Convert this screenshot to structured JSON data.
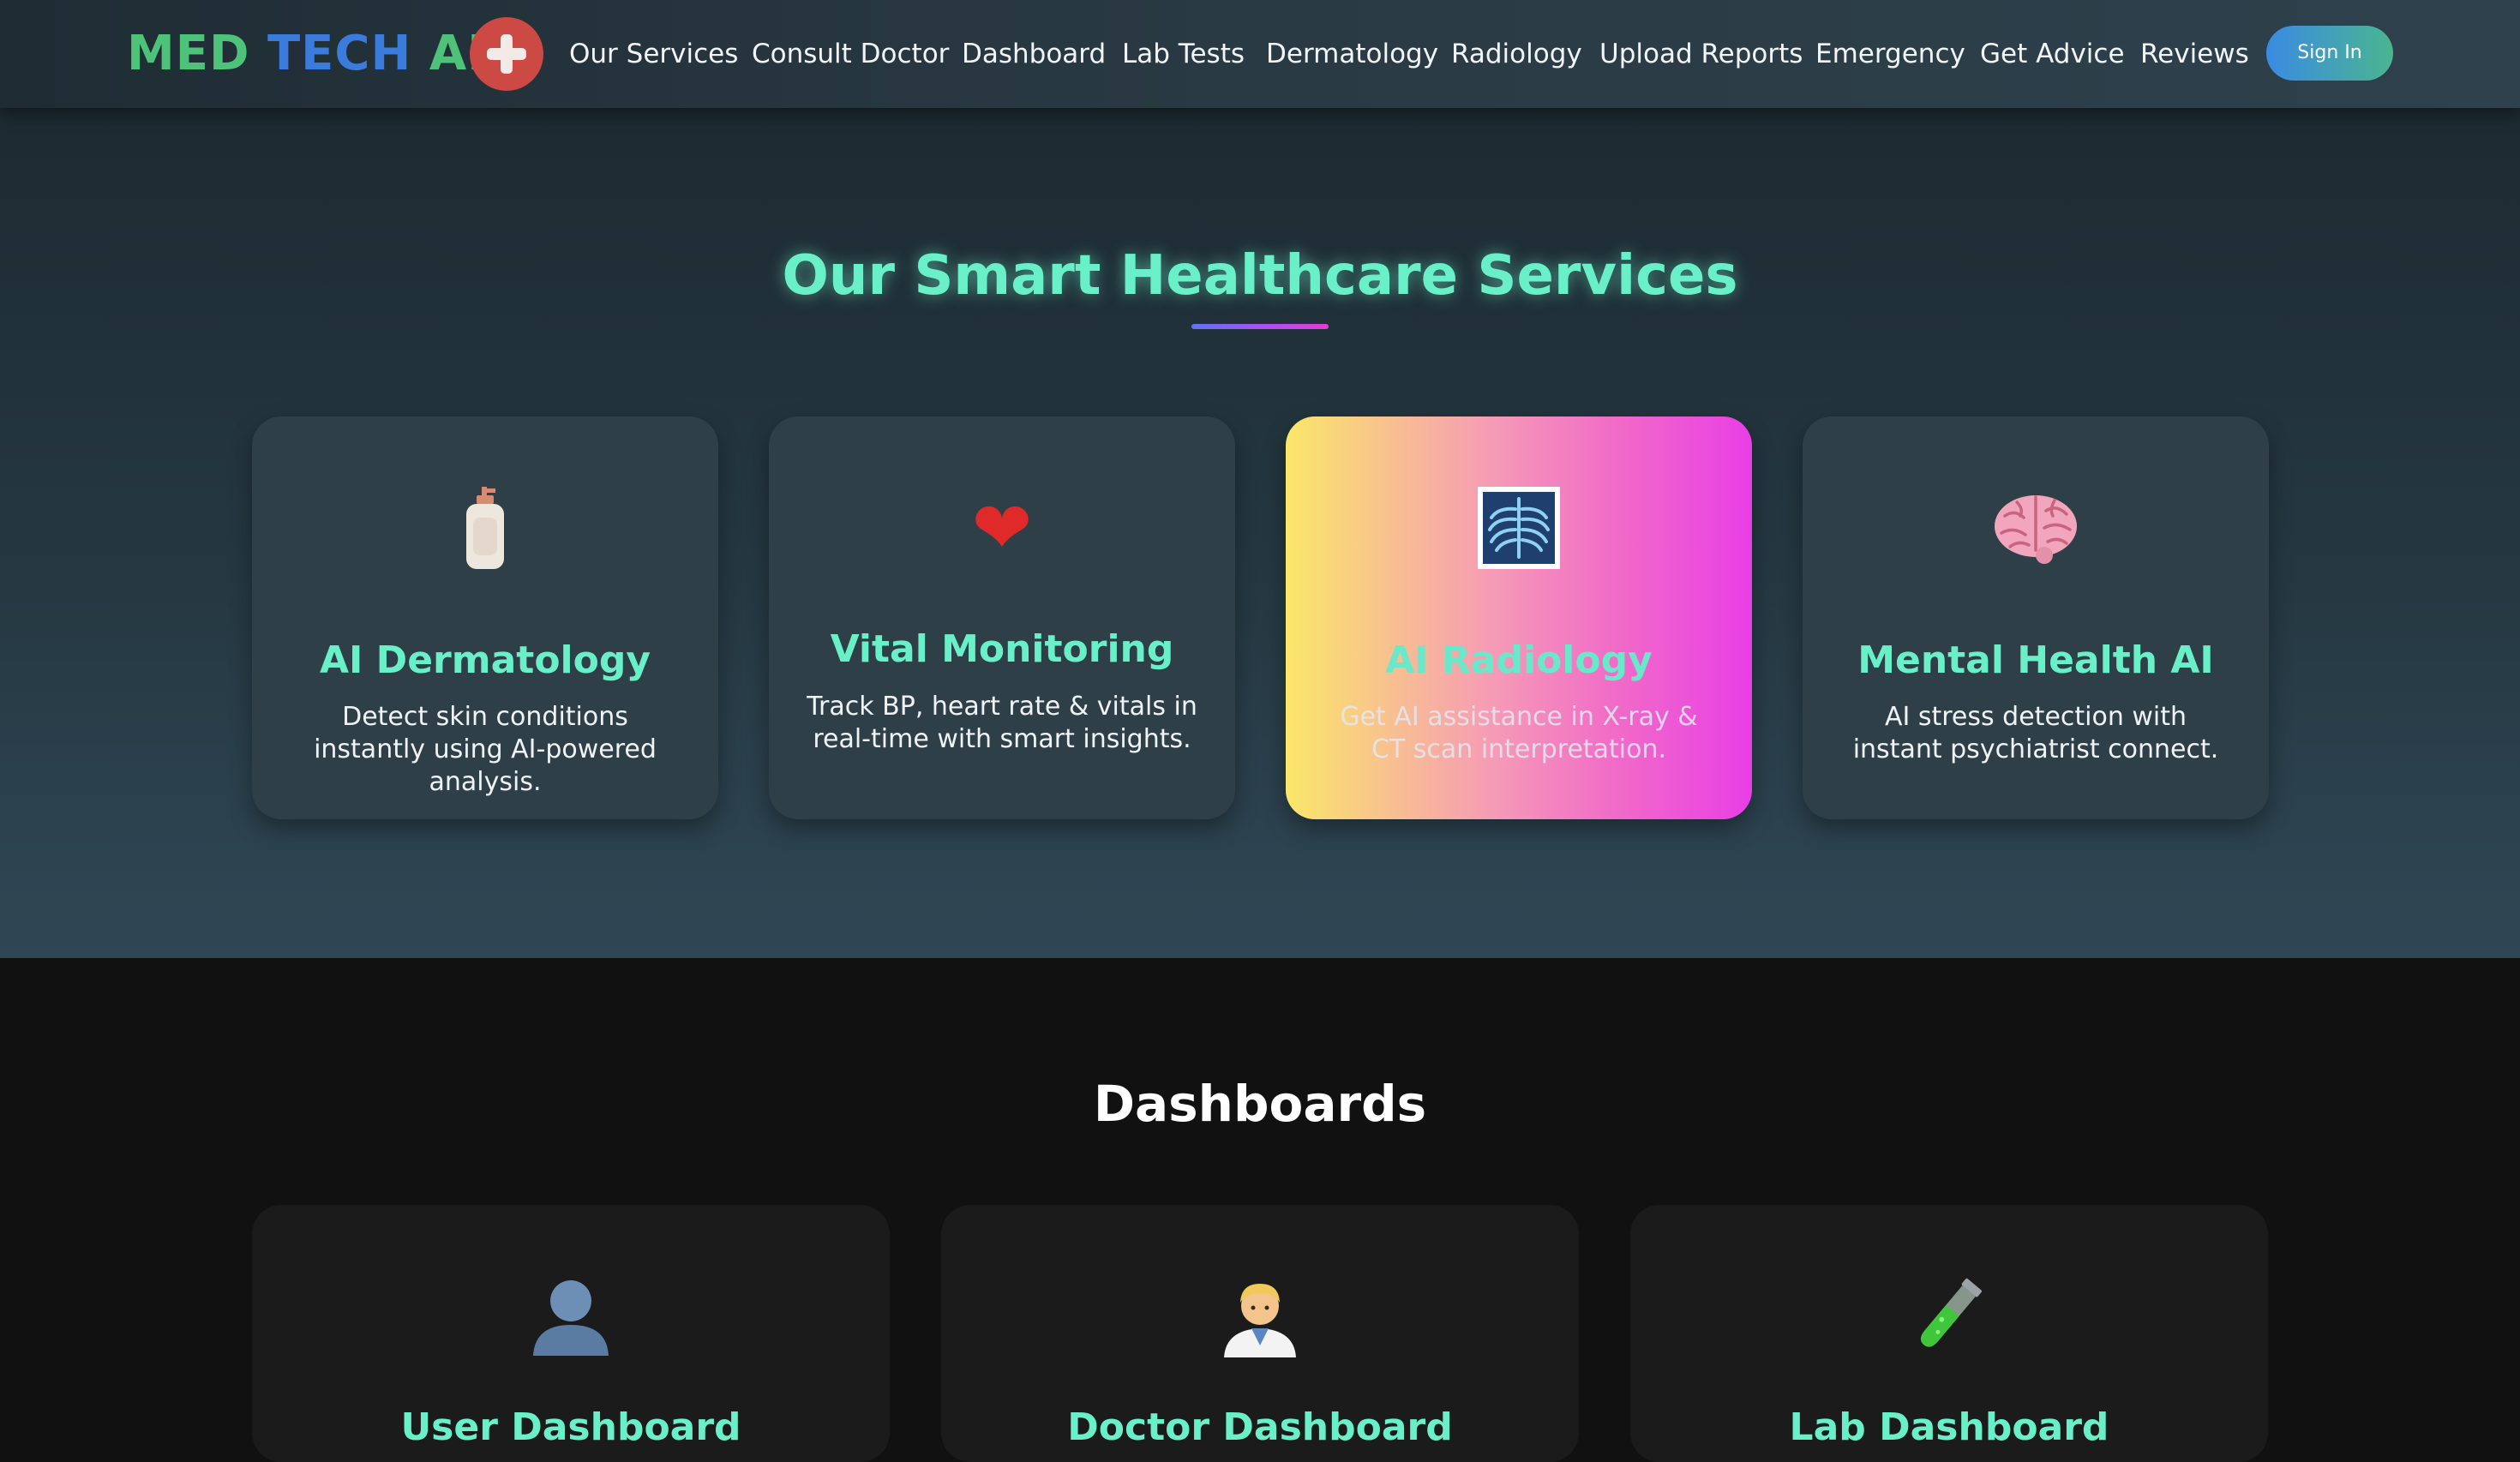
{
  "brand": {
    "part1": "MED",
    "part2": "TECH",
    "part3": "AI",
    "logo_icon": "red-cross-icon",
    "colors": {
      "green": "#4fc27a",
      "blue": "#3b7bdc",
      "cross_bg": "#cc4a43"
    }
  },
  "nav": {
    "items": [
      {
        "label": "Our Services"
      },
      {
        "label": "Consult Doctor"
      },
      {
        "label": "Dashboard"
      },
      {
        "label": "Lab Tests"
      },
      {
        "label": "Dermatology"
      },
      {
        "label": "Radiology"
      },
      {
        "label": "Upload Reports"
      },
      {
        "label": "Emergency"
      },
      {
        "label": "Get Advice"
      },
      {
        "label": "Reviews"
      }
    ],
    "sign_in": "Sign In"
  },
  "services": {
    "title": "Our Smart Healthcare Services",
    "cards": [
      {
        "icon": "lotion-bottle-icon",
        "title": "AI Dermatology",
        "desc": "Detect skin conditions instantly using AI-powered analysis.",
        "active": false
      },
      {
        "icon": "heart-icon",
        "title": "Vital Monitoring",
        "desc": "Track BP, heart rate & vitals in real-time with smart insights.",
        "active": false
      },
      {
        "icon": "x-ray-icon",
        "title": "AI Radiology",
        "desc": "Get AI assistance in X-ray & CT scan interpretation.",
        "active": true
      },
      {
        "icon": "brain-icon",
        "title": "Mental Health AI",
        "desc": "AI stress detection with instant psychiatrist connect.",
        "active": false
      }
    ],
    "accent_color": "#69f0c8"
  },
  "dashboards": {
    "title": "Dashboards",
    "cards": [
      {
        "icon": "user-silhouette-icon",
        "label": "User Dashboard"
      },
      {
        "icon": "doctor-icon",
        "label": "Doctor Dashboard"
      },
      {
        "icon": "test-tube-icon",
        "label": "Lab Dashboard"
      }
    ]
  }
}
